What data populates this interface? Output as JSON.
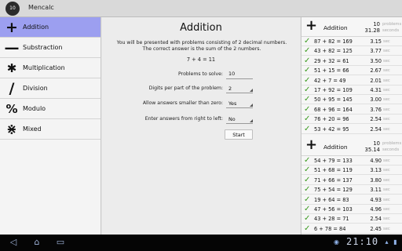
{
  "app": {
    "icon_text": "10",
    "title": "Mencalc"
  },
  "operations": [
    {
      "icon": "+",
      "label": "Addition",
      "active": true
    },
    {
      "icon": "—",
      "label": "Substraction",
      "active": false
    },
    {
      "icon": "✱",
      "label": "Multiplication",
      "active": false
    },
    {
      "icon": "/",
      "label": "Division",
      "active": false
    },
    {
      "icon": "%",
      "label": "Modulo",
      "active": false
    },
    {
      "icon": "⋇",
      "label": "Mixed",
      "active": false
    }
  ],
  "form": {
    "title": "Addition",
    "instructions": "You will be presented with problems consisting of 2 decimal numbers. The correct answer is the sum of the 2 numbers.",
    "example": "7 + 4 = 11",
    "problems_label": "Problems to solve:",
    "problems_value": "10",
    "digits_label": "Digits per part of the problem:",
    "digits_value": "2",
    "below_zero_label": "Allow answers smaller than zero:",
    "below_zero_value": "Yes",
    "rtl_label": "Enter answers from right to left:",
    "rtl_value": "No",
    "start_label": "Start"
  },
  "results": {
    "problems_unit": "problems",
    "seconds_unit": "seconds",
    "sec_unit": "sec",
    "groups": [
      {
        "title": "Addition",
        "count": "10",
        "total": "31.28",
        "rows": [
          {
            "eq": "87 + 82 = 169",
            "t": "3.15"
          },
          {
            "eq": "43 + 82 = 125",
            "t": "3.77"
          },
          {
            "eq": "29 + 32 = 61",
            "t": "3.50"
          },
          {
            "eq": "51 + 15 = 66",
            "t": "2.67"
          },
          {
            "eq": "42 + 7 = 49",
            "t": "2.01"
          },
          {
            "eq": "17 + 92 = 109",
            "t": "4.31"
          },
          {
            "eq": "50 + 95 = 145",
            "t": "3.00"
          },
          {
            "eq": "68 + 96 = 164",
            "t": "3.76"
          },
          {
            "eq": "76 + 20 = 96",
            "t": "2.54"
          },
          {
            "eq": "53 + 42 = 95",
            "t": "2.54"
          }
        ]
      },
      {
        "title": "Addition",
        "count": "10",
        "total": "35.14",
        "rows": [
          {
            "eq": "54 + 79 = 133",
            "t": "4.90"
          },
          {
            "eq": "51 + 68 = 119",
            "t": "3.13"
          },
          {
            "eq": "71 + 66 = 137",
            "t": "3.80"
          },
          {
            "eq": "75 + 54 = 129",
            "t": "3.11"
          },
          {
            "eq": "19 + 64 = 83",
            "t": "4.93"
          },
          {
            "eq": "47 + 56 = 103",
            "t": "4.96"
          },
          {
            "eq": "43 + 28 = 71",
            "t": "2.54"
          },
          {
            "eq": "6 + 78 = 84",
            "t": "2.45"
          }
        ]
      }
    ]
  },
  "system": {
    "clock": "21:10"
  },
  "colors": {
    "active_item": "#9c9ff0",
    "check": "#3b9a1f",
    "system_bar": "#050505"
  }
}
